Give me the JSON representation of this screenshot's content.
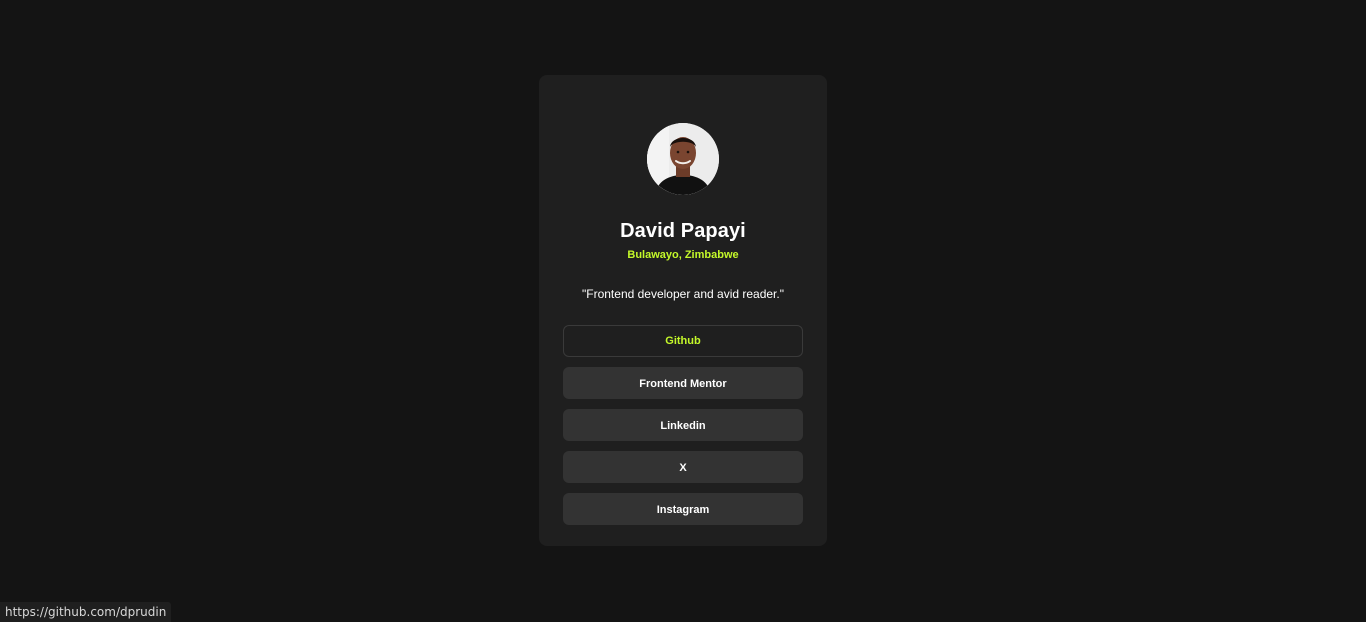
{
  "profile": {
    "name": "David Papayi",
    "location": "Bulawayo, Zimbabwe",
    "bio": "\"Frontend developer and avid reader.\""
  },
  "links": [
    {
      "label": "Github",
      "active": true
    },
    {
      "label": "Frontend Mentor",
      "active": false
    },
    {
      "label": "Linkedin",
      "active": false
    },
    {
      "label": "X",
      "active": false
    },
    {
      "label": "Instagram",
      "active": false
    }
  ],
  "status_bar": {
    "url": "https://github.com/dprudin"
  },
  "colors": {
    "background": "#141414",
    "card": "#1f1f1f",
    "button": "#333333",
    "accent": "#c4f82a"
  }
}
